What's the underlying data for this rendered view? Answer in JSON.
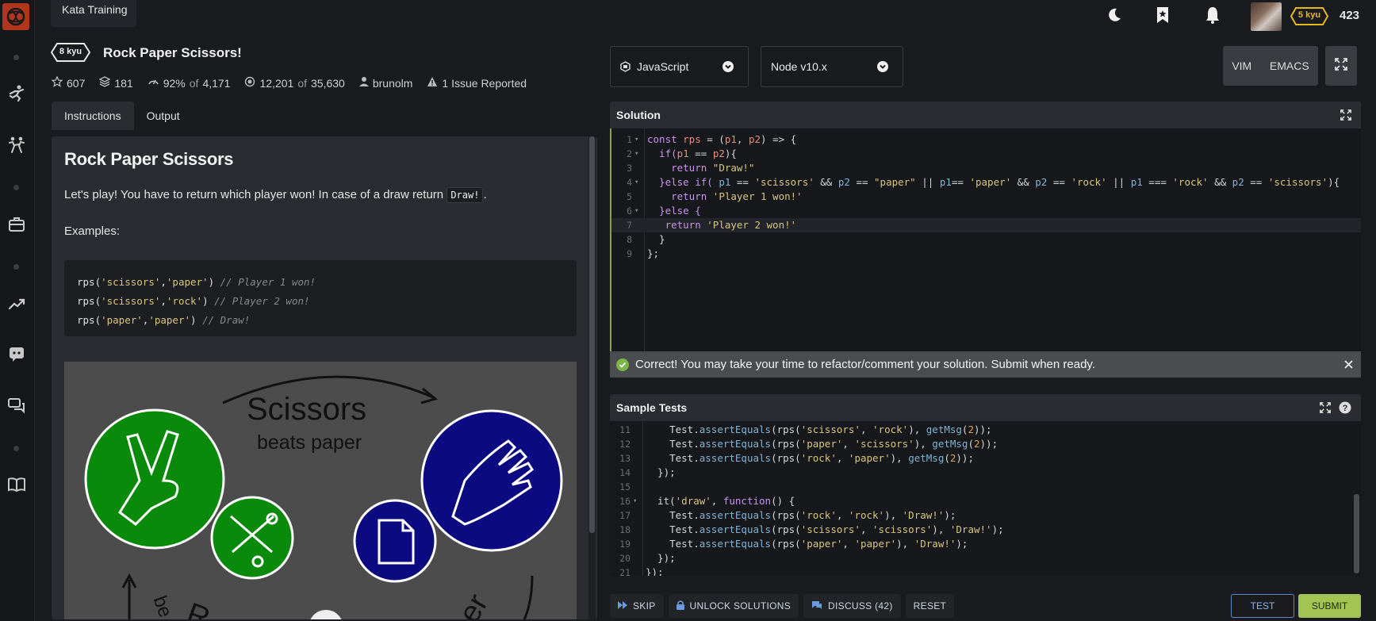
{
  "header": {
    "kata_tab_label": "Kata Training",
    "rank_badge": "5 kyu",
    "honor": "423"
  },
  "kata": {
    "rank": "8 kyu",
    "title": "Rock Paper Scissors!",
    "stats": {
      "stars": "607",
      "collections": "181",
      "satisfaction": "92%",
      "satisfaction_of": "of",
      "votes": "4,171",
      "completed": "12,201",
      "completed_of": "of",
      "attempts": "35,630",
      "author": "brunolm",
      "issues": "1 Issue Reported"
    }
  },
  "tabs": [
    {
      "label": "Instructions"
    },
    {
      "label": "Output"
    }
  ],
  "instructions": {
    "heading": "Rock Paper Scissors",
    "intro_before": "Let's play! You have to return which player won! In case of a draw return ",
    "intro_code": "Draw!",
    "intro_after": ".",
    "examples_label": "Examples:",
    "examples": [
      {
        "call_fn": "rps(",
        "a1": "'scissors'",
        "sep": ",",
        "a2": "'paper'",
        "close": ") ",
        "comment": "// Player 1 won!"
      },
      {
        "call_fn": "rps(",
        "a1": "'scissors'",
        "sep": ",",
        "a2": "'rock'",
        "close": ") ",
        "comment": "// Player 2 won!"
      },
      {
        "call_fn": "rps(",
        "a1": "'paper'",
        "sep": ",",
        "a2": "'paper'",
        "close": ") ",
        "comment": "// Draw!"
      }
    ],
    "image": {
      "scissors_title": "Scissors",
      "scissors_sub": "beats paper",
      "partial_left": "R",
      "partial_left2": "be",
      "partial_right": "er"
    }
  },
  "toolbar": {
    "language": "JavaScript",
    "version": "Node v10.x",
    "vim": "VIM",
    "emacs": "EMACS"
  },
  "solution": {
    "title": "Solution",
    "lines": [
      {
        "n": "1",
        "fold": "▾"
      },
      {
        "n": "2",
        "fold": "▾"
      },
      {
        "n": "3",
        "fold": ""
      },
      {
        "n": "4",
        "fold": "▾"
      },
      {
        "n": "5",
        "fold": ""
      },
      {
        "n": "6",
        "fold": "▾"
      },
      {
        "n": "7",
        "fold": ""
      },
      {
        "n": "8",
        "fold": ""
      },
      {
        "n": "9",
        "fold": ""
      }
    ],
    "code": {
      "l1a": "const ",
      "l1b": "rps",
      "l1c": " = (",
      "l1d": "p1",
      "l1e": ", ",
      "l1f": "p2",
      "l1g": ") => {",
      "l2a": "  if(",
      "l2b": "p1",
      "l2c": " == ",
      "l2d": "p2",
      "l2e": "){",
      "l3a": "    return ",
      "l3b": "\"Draw!\"",
      "l4a": "  }else if( ",
      "l4b": "p1",
      "l4c": " == ",
      "l4d": "'scissors'",
      "l4e": " && ",
      "l4f": "p2",
      "l4g": " == ",
      "l4h": "\"paper\"",
      "l4i": " || ",
      "l4j": "p1",
      "l4k": "== ",
      "l4l": "'paper'",
      "l4m": " && ",
      "l4n": "p2",
      "l4o": " == ",
      "l4p": "'rock'",
      "l4q": " || ",
      "l4r": "p1",
      "l4s": " === ",
      "l4t": "'rock'",
      "l4u": " && ",
      "l4v": "p2",
      "l4w": " == ",
      "l4x": "'scissors'",
      "l4y": "){",
      "l5a": "    return ",
      "l5b": "'Player 1 won!'",
      "l6a": "  }else {",
      "l7a": "   return ",
      "l7b": "'Player 2 won!'",
      "l8a": "  }",
      "l9a": "};"
    }
  },
  "success_message": "Correct! You may take your time to refactor/comment your solution. Submit when ready.",
  "sample_tests": {
    "title": "Sample Tests",
    "lines": [
      {
        "n": "11",
        "fold": "",
        "obj": "Test",
        "fn": "assertEquals",
        "a": "rps(",
        "s1": "'scissors'",
        "c": ", ",
        "s2": "'rock'",
        "d": "), ",
        "g": "getMsg",
        "e": "(",
        "num": "2",
        "f": "));"
      },
      {
        "n": "12",
        "fold": "",
        "obj": "Test",
        "fn": "assertEquals",
        "a": "rps(",
        "s1": "'paper'",
        "c": ", ",
        "s2": "'scissors'",
        "d": "), ",
        "g": "getMsg",
        "e": "(",
        "num": "2",
        "f": "));"
      },
      {
        "n": "13",
        "fold": "",
        "obj": "Test",
        "fn": "assertEquals",
        "a": "rps(",
        "s1": "'rock'",
        "c": ", ",
        "s2": "'paper'",
        "d": "), ",
        "g": "getMsg",
        "e": "(",
        "num": "2",
        "f": "));"
      }
    ],
    "l14": "  });",
    "l16a": "  it(",
    "l16b": "'draw'",
    "l16c": ", ",
    "l16d": "function",
    "l16e": "() {",
    "draw_lines": [
      {
        "n": "17",
        "obj": "Test",
        "fn": "assertEquals",
        "a": "rps(",
        "s1": "'rock'",
        "c": ", ",
        "s2": "'rock'",
        "d": "), ",
        "r": "'Draw!'",
        "f": ");"
      },
      {
        "n": "18",
        "obj": "Test",
        "fn": "assertEquals",
        "a": "rps(",
        "s1": "'scissors'",
        "c": ", ",
        "s2": "'scissors'",
        "d": "), ",
        "r": "'Draw!'",
        "f": ");"
      },
      {
        "n": "19",
        "obj": "Test",
        "fn": "assertEquals",
        "a": "rps(",
        "s1": "'paper'",
        "c": ", ",
        "s2": "'paper'",
        "d": "), ",
        "r": "'Draw!'",
        "f": ");"
      }
    ],
    "l20": "  });",
    "l21": "});"
  },
  "actions": {
    "skip": "SKIP",
    "unlock": "UNLOCK SOLUTIONS",
    "discuss": "DISCUSS (42)",
    "reset": "RESET",
    "test": "TEST",
    "submit": "SUBMIT"
  },
  "colors": {
    "accent_green": "#a3c453",
    "rank_gold": "#e6b820",
    "logo_red": "#b1361e",
    "test_blue": "#5a8ac8"
  }
}
